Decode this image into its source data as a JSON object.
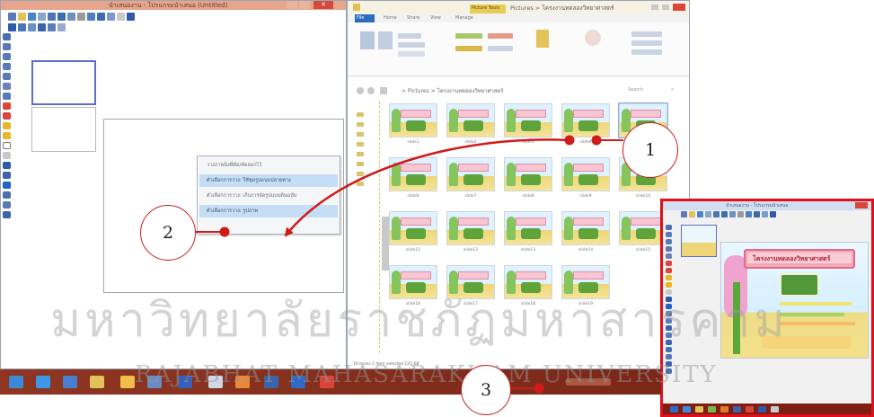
{
  "program_window": {
    "title": "นำเสนองาน - โปรแกรมนำเสนอ (Untitled)",
    "context_menu": [
      "วางภาพนิ่งที่ตัด/คัดลอกไว้",
      "ตัวเลือกการวาง: ใช้ชุดรูปแบบปลายทาง",
      "ตัวเลือกการวาง: เก็บการจัดรูปแบบต้นฉบับ",
      "ตัวเลือกการวาง: รูปภาพ"
    ]
  },
  "explorer": {
    "title_tag": "Picture Tools",
    "title_path": "Pictures > โครงงานทดลองวิทยาศาสตร์",
    "tabs": [
      "File",
      "Home",
      "Share",
      "View",
      "Manage"
    ],
    "address": "> Pictures > โครงงานทดลองวิทยาศาสตร์",
    "search_placeholder": "Search",
    "files": [
      "slide1",
      "slide2",
      "slide3",
      "slide4",
      "slide5",
      "slide6",
      "slide7",
      "slide8",
      "slide9",
      "slide10",
      "slide11",
      "slide12",
      "slide13",
      "slide14",
      "slide15",
      "slide16",
      "slide17",
      "slide18",
      "slide19"
    ],
    "status": "19 items   1 item selected  125 KB"
  },
  "preview": {
    "title": "นำเสนองาน - โปรแกรมนำเสนอ",
    "slide_heading": "โครงงานทดลองวิทยาศาสตร์"
  },
  "callouts": {
    "c1": "1",
    "c2": "2",
    "c3": "3"
  },
  "watermark": {
    "thai": "มหาวิทยาลัยราชภัฏมหาสารคาม",
    "english": "RAJABHAT MAHASARAKHAM UNIVERSITY"
  },
  "colors": {
    "annotation_red": "#d11a1a",
    "taskbar": "#8e3622",
    "preview_border": "#e10f19"
  }
}
